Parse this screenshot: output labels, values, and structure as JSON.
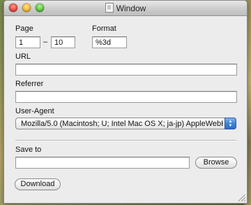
{
  "window": {
    "title": "Window"
  },
  "form": {
    "page_label": "Page",
    "page_from": "1",
    "page_separator": "–",
    "page_to": "10",
    "format_label": "Format",
    "format_value": "%3d",
    "url_label": "URL",
    "url_value": "",
    "referrer_label": "Referrer",
    "referrer_value": "",
    "useragent_label": "User-Agent",
    "useragent_selected": "Mozilla/5.0 (Macintosh; U; Intel Mac OS X; ja-jp) AppleWebKit...",
    "saveto_label": "Save to",
    "saveto_value": "",
    "browse_label": "Browse",
    "download_label": "Download"
  },
  "icons": {
    "close": "close-traffic-light-icon",
    "minimize": "minimize-traffic-light-icon",
    "maximize": "zoom-traffic-light-icon",
    "document": "document-icon",
    "select_arrows": "up-down-arrows-icon",
    "resize": "resize-grip-icon"
  },
  "colors": {
    "window_bg": "#ececec",
    "accent_blue": "#3d85d8"
  }
}
